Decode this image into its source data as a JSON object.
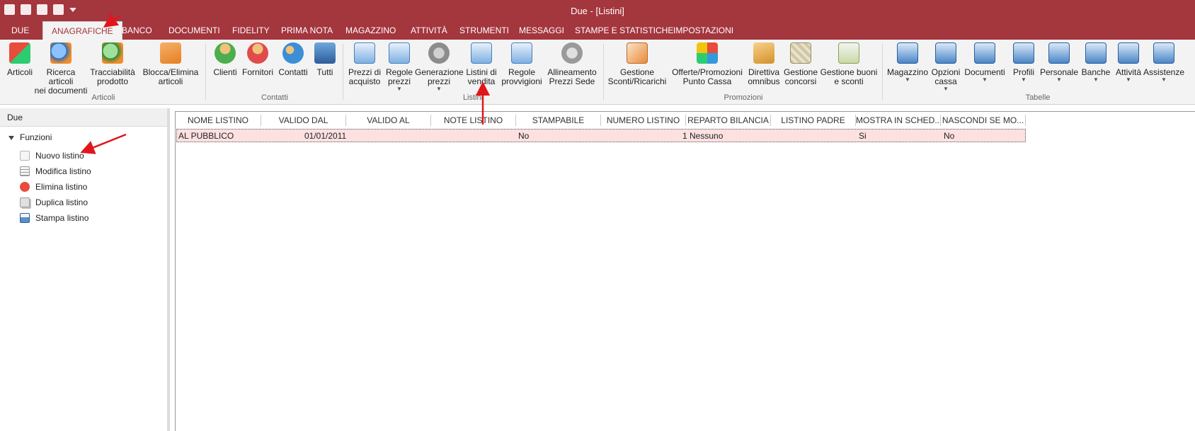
{
  "window": {
    "title": "Due - [Listini]"
  },
  "quick_access": [
    "app-icon",
    "calendar-icon",
    "tools-icon",
    "record-icon",
    "dropdown-icon"
  ],
  "tabs": [
    {
      "label": "DUE"
    },
    {
      "label": "ANAGRAFICHE"
    },
    {
      "label": "BANCO"
    },
    {
      "label": "DOCUMENTI"
    },
    {
      "label": "FIDELITY"
    },
    {
      "label": "PRIMA NOTA"
    },
    {
      "label": "MAGAZZINO"
    },
    {
      "label": "ATTIVITÀ"
    },
    {
      "label": "STRUMENTI"
    },
    {
      "label": "MESSAGGI"
    },
    {
      "label": "STAMPE E STATISTICHE"
    },
    {
      "label": "IMPOSTAZIONI"
    }
  ],
  "ribbon": {
    "groups": {
      "articoli": "Articoli",
      "contatti": "Contatti",
      "listini": "Listini",
      "promozioni": "Promozioni",
      "tabelle": "Tabelle"
    },
    "buttons": {
      "articoli": [
        "Articoli",
        ""
      ],
      "ricerca": [
        "Ricerca articoli",
        "nei documenti"
      ],
      "tracciabilita": [
        "Tracciabilità",
        "prodotto"
      ],
      "blocca": [
        "Blocca/Elimina",
        "articoli"
      ],
      "clienti": [
        "Clienti",
        ""
      ],
      "fornitori": [
        "Fornitori",
        ""
      ],
      "contatti": [
        "Contatti",
        ""
      ],
      "tutti": [
        "Tutti",
        ""
      ],
      "prezzi_acquisto": [
        "Prezzi di",
        "acquisto"
      ],
      "regole_prezzi": [
        "Regole",
        "prezzi"
      ],
      "generazione_prezzi": [
        "Generazione",
        "prezzi"
      ],
      "listini_vendita": [
        "Listini di",
        "vendita"
      ],
      "regole_provvigioni": [
        "Regole",
        "provvigioni"
      ],
      "allineamento": [
        "Allineamento",
        "Prezzi Sede"
      ],
      "gestione_sconti": [
        "Gestione",
        "Sconti/Ricarichi"
      ],
      "offerte": [
        "Offerte/Promozioni",
        "Punto Cassa"
      ],
      "direttiva": [
        "Direttiva",
        "omnibus"
      ],
      "concorsi": [
        "Gestione",
        "concorsi"
      ],
      "buoni": [
        "Gestione buoni",
        "e sconti"
      ],
      "magazzino": [
        "Magazzino",
        ""
      ],
      "opzioni_cassa": [
        "Opzioni",
        "cassa"
      ],
      "documenti": [
        "Documenti",
        ""
      ],
      "profili": [
        "Profili",
        ""
      ],
      "personale": [
        "Personale",
        ""
      ],
      "banche": [
        "Banche",
        ""
      ],
      "attivita": [
        "Attività",
        ""
      ],
      "assistenze": [
        "Assistenze",
        ""
      ]
    }
  },
  "left_panel": {
    "title": "Due",
    "group": "Funzioni",
    "items": [
      {
        "label": "Nuovo listino",
        "icon": "new-document-icon"
      },
      {
        "label": "Modifica listino",
        "icon": "edit-document-icon"
      },
      {
        "label": "Elimina listino",
        "icon": "delete-icon"
      },
      {
        "label": "Duplica listino",
        "icon": "copy-icon"
      },
      {
        "label": "Stampa listino",
        "icon": "printer-icon"
      }
    ]
  },
  "grid": {
    "columns": [
      "NOME LISTINO",
      "VALIDO DAL",
      "VALIDO AL",
      "NOTE LISTINO",
      "STAMPABILE",
      "NUMERO LISTINO",
      "REPARTO BILANCIA",
      "LISTINO PADRE",
      "MOSTRA IN SCHED...",
      "NASCONDI SE MO..."
    ],
    "rows": [
      {
        "nome": "AL PUBBLICO",
        "valido_dal": "01/01/2011",
        "valido_al": "",
        "note": "",
        "stampabile": "No",
        "numero": "1",
        "reparto": "Nessuno",
        "padre": "",
        "mostra": "Si",
        "nascondi": "No"
      }
    ]
  },
  "colors": {
    "accent": "#a4363e",
    "selection": "#fde1e1",
    "annotation_arrow": "#e0161b"
  }
}
